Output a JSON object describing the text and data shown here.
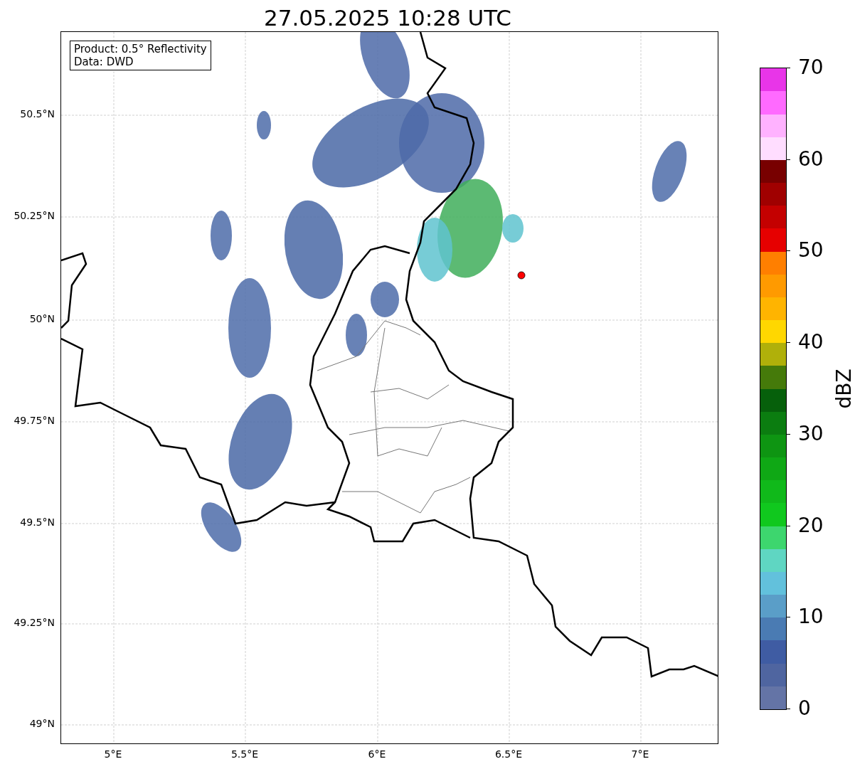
{
  "title": "27.05.2025 10:28 UTC",
  "legend": {
    "lines": [
      "Product: 0.5° Reflectivity",
      "Data: DWD"
    ]
  },
  "lat_ticks": [
    "50.5°N",
    "50.25°N",
    "50°N",
    "49.75°N",
    "49.5°N",
    "49.25°N",
    "49°N"
  ],
  "lon_ticks": [
    "5°E",
    "5.5°E",
    "6°E",
    "6.5°E",
    "7°E"
  ],
  "colorbar": {
    "label": "dBZ",
    "ticks": [
      "70",
      "60",
      "50",
      "40",
      "30",
      "20",
      "10",
      "0"
    ],
    "segments": [
      {
        "color": "#6474a6"
      },
      {
        "color": "#4f65a0"
      },
      {
        "color": "#3f5ca3"
      },
      {
        "color": "#4a7bb3"
      },
      {
        "color": "#5a9ec8"
      },
      {
        "color": "#62c1dc"
      },
      {
        "color": "#5fd6c2"
      },
      {
        "color": "#3dd66e"
      },
      {
        "color": "#10c81e"
      },
      {
        "color": "#10b91a"
      },
      {
        "color": "#0fa815"
      },
      {
        "color": "#0e9512"
      },
      {
        "color": "#0b7d10"
      },
      {
        "color": "#06600b"
      },
      {
        "color": "#457a0a"
      },
      {
        "color": "#b0b00a"
      },
      {
        "color": "#ffd700"
      },
      {
        "color": "#ffb400"
      },
      {
        "color": "#ff9a00"
      },
      {
        "color": "#ff7f00"
      },
      {
        "color": "#e60000"
      },
      {
        "color": "#c40000"
      },
      {
        "color": "#a00000"
      },
      {
        "color": "#780000"
      },
      {
        "color": "#ffddff"
      },
      {
        "color": "#ffb2ff"
      },
      {
        "color": "#ff6aff"
      },
      {
        "color": "#e835e8"
      }
    ]
  }
}
